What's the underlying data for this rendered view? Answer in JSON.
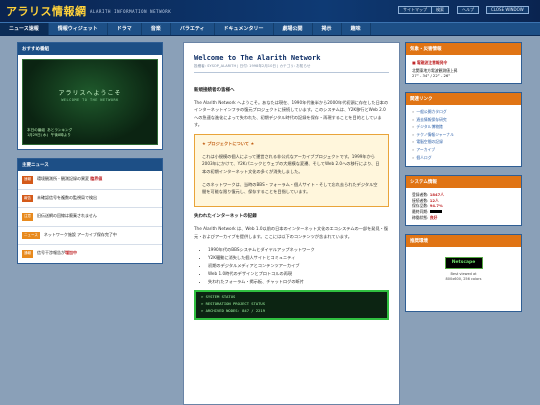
{
  "header": {
    "logo": "アラリス情報網",
    "subtitle": "ALARITH INFORMATION NETWORK",
    "buttons": [
      "サイトマップ",
      "検索",
      "ヘルプ",
      "CLOSE WINDOW"
    ]
  },
  "nav": [
    "ニュース速報",
    "情報ウィジェット",
    "ドラマ",
    "音楽",
    "バラエティ",
    "ドキュメンタリー",
    "劇場公開",
    "掲示",
    "趣味"
  ],
  "left": {
    "welcome_title": "おすすめ番組",
    "term_title": "アラリスへようこそ",
    "term_sub": "WELCOME TO THE NETWORK",
    "term_foot": [
      "本日の番組 あとランキング",
      "1月29日(水) 午後8時より"
    ],
    "news_title": "主要ニュース",
    "news": [
      {
        "tag": "速報",
        "text": "環境観測所 - 観測記録の異変 ",
        "highlight": "臨界値",
        "tag_color": "red"
      },
      {
        "tag": "報告",
        "text": "未確認信号を複数の監視局で検出",
        "highlight": "",
        "tag_color": "red"
      },
      {
        "tag": "注意",
        "text": "旧伝送網の回線は廃棄されません",
        "highlight": "",
        "tag_color": "orange"
      },
      {
        "tag": "ニュース",
        "text": "ネットワーク施設 アーカイブ保存完了中",
        "highlight": "",
        "tag_color": "orange"
      },
      {
        "tag": "通報",
        "text": "信号干渉報告が",
        "highlight": "増加中",
        "tag_color": "orange"
      }
    ]
  },
  "article": {
    "title": "Welcome to The Alarith Network",
    "meta": "投稿者: SYSOP_ALARITH | 日付: 1998年2月10日 | カテゴリ: お知らせ",
    "greeting": "新規接続者の皆様へ",
    "intro": "The Alarith Network へようこそ。あなたは現在、1990年代後半から2000年代初頭に存在した日本のインターネットインフラの復元プロジェクトに接続しています。このシステムは、Y2K移行とWeb 2.0への急速な進化によって失われた、初期デジタル時代の記録を保存・再現することを目的としています。",
    "notice_title": "プロジェクトについて",
    "notice_p1": "これは小規模の個人によって運営される非公式なアーカイブプロジェクトです。1999年から2003年にかけて、Y2Kパニックとウェブの大規模な変遷、そしてWeb 2.0への移行により、日本の初期インターネット文化の多くが消失しました。",
    "notice_p2": "このネットワークは、当時のBBS・フォーラム・個人サイト・そして忘れ去られたデジタル空間を可能な限り復元し、保存することを目指しています。",
    "section_title": "失われたインターネットの記録",
    "section_p": "The Alarith Network は、Web 1.0以前の日本のインターネット文化のエコシステムの一部を発見・復元・およびアーカイブを提供します。ここには以下のコンテンツが含まれています。",
    "bullets": [
      "1990年代のBBSシステムとダイヤルアップネットワーク",
      "Y2K騒動に消失した個人サイトとコミュニティ",
      "初期のデジタルメディアとコンテンツアーカイブ",
      "Web 1.0時代のデザインとプロトコルの再現",
      "失われたフォーラム・掲示板、チャットログの断片"
    ],
    "code_lines": [
      "> SYSTEM STATUS",
      "> RESTORATION PROJECT STATUS",
      "> ARCHIVED NODES: 847 / 2219"
    ]
  },
  "right": {
    "alert_title": "気象・災害情報",
    "alert_link": "■ 電磁波注意報発令",
    "alert_text": [
      "北関東地方電波観測値上昇",
      "27° - 34° / 22° - 26°"
    ],
    "links_title": "関連リンク",
    "links": [
      "一般公開カタログ",
      "過去情報保存研究",
      "デジタル博物館",
      "テクノ情報ジャーナル",
      "電脳空間の記録",
      "アーカイブ",
      "個人ログ"
    ],
    "sys_title": "システム情報",
    "stats": [
      {
        "label": "登録者数: ",
        "value": "1847人"
      },
      {
        "label": "接続者数: ",
        "value": "12人"
      },
      {
        "label": "保存品数: ",
        "value": "94.7%"
      },
      {
        "label": "最終同期: ",
        "value": ""
      },
      {
        "label": "稼働状態: ",
        "value": "良好"
      }
    ],
    "browser_title": "推奨環境",
    "netscape": "Netscape",
    "browser_text": [
      "Best viewed at",
      "800x600, 256 colors"
    ]
  },
  "colors": {
    "accent": "#1d4f86",
    "highlight": "#c0282a",
    "orange": "#e07414"
  }
}
